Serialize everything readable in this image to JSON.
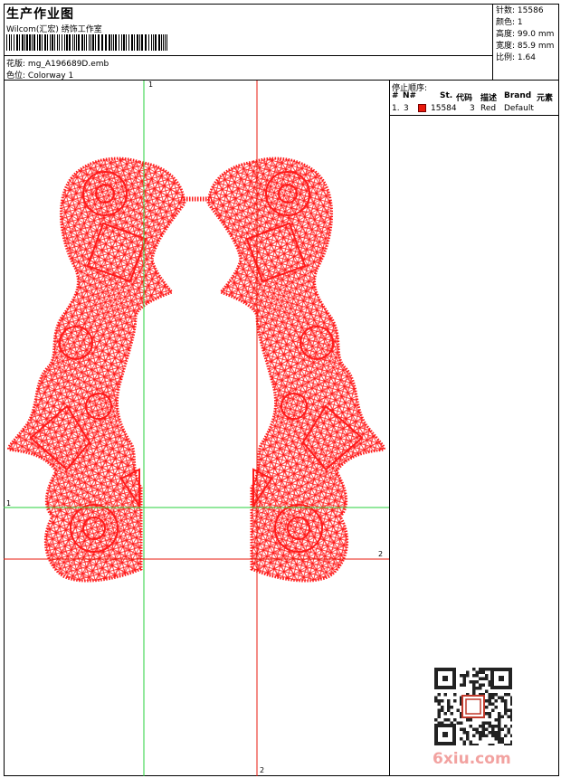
{
  "header": {
    "title": "生产作业图",
    "company": "Wilcom(汇宏) 绣饰工作室",
    "design_label": "花版:",
    "design_file": "mg_A196689D.emb",
    "colorway_label": "色位:",
    "colorway": "Colorway 1"
  },
  "stats": [
    {
      "label": "针数:",
      "value": "15586"
    },
    {
      "label": "颜色:",
      "value": "1"
    },
    {
      "label": "高度:",
      "value": "99.0 mm"
    },
    {
      "label": "宽度:",
      "value": "85.9 mm"
    },
    {
      "label": "比例:",
      "value": "1.64"
    }
  ],
  "canvas": {
    "guides": {
      "green_v_top": "1",
      "green_h_left": "1",
      "red_h_right": "2",
      "red_v_bottom": "2"
    },
    "colors": {
      "green_guide": "#27d23b",
      "red_guide": "#e8190c",
      "stitch": "#ff1a1a"
    }
  },
  "stop_sequence": {
    "title": "停止顺序:",
    "columns": {
      "number": "#",
      "needle": "N#",
      "stitches": "St.",
      "code": "代码",
      "description": "描述",
      "brand": "Brand",
      "element": "元素"
    },
    "rows": [
      {
        "number": "1.",
        "needle": "3",
        "color_hex": "#e8190c",
        "stitches": "15584",
        "code": "3",
        "description": "Red",
        "brand": "Default"
      }
    ]
  },
  "watermark": {
    "text": "6xiu.com",
    "color": "#f2a2a0"
  },
  "qr_stamp_icon": "qr-code-icon"
}
